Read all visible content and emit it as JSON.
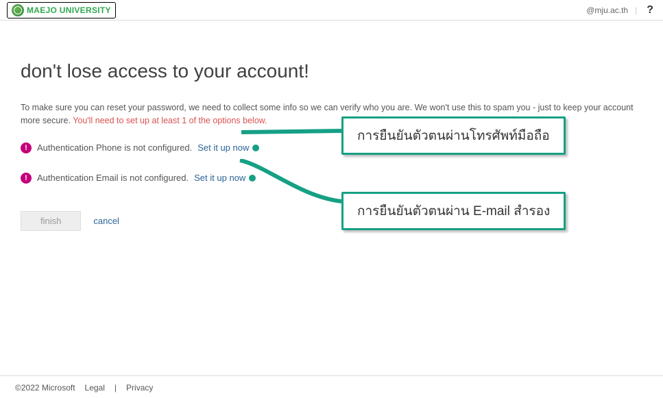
{
  "header": {
    "brand": "MAEJO UNIVERSITY",
    "user_email": "@mju.ac.th",
    "help": "?"
  },
  "page": {
    "title": "don't lose access to your account!",
    "intro_1": "To make sure you can reset your password, we need to collect some info so we can verify who you are. We won't use this to spam you - just to keep your account more secure. ",
    "intro_warn": "You'll need to set up at least 1 of the options below."
  },
  "options": {
    "phone_text": "Authentication Phone is not configured. ",
    "email_text": "Authentication Email is not configured. ",
    "setup_link": "Set it up now"
  },
  "actions": {
    "finish": "finish",
    "cancel": "cancel"
  },
  "callouts": {
    "c1": "การยืนยันตัวตนผ่านโทรศัพท์มือถือ",
    "c2": "การยืนยันตัวตนผ่าน E-mail สำรอง"
  },
  "footer": {
    "copyright": "©2022 Microsoft",
    "legal": "Legal",
    "privacy": "Privacy"
  }
}
